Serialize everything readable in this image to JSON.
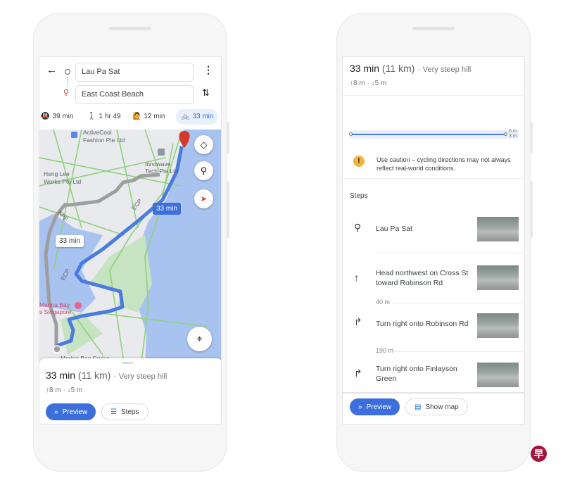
{
  "left_phone": {
    "search": {
      "origin": "Lau Pa Sat",
      "destination": "East Coast Beach"
    },
    "modes": [
      {
        "icon": "transit-icon",
        "label": "39 min"
      },
      {
        "icon": "walk-icon",
        "label": "1 hr 49"
      },
      {
        "icon": "ride-hailing-icon",
        "label": "12 min"
      },
      {
        "icon": "bicycle-icon",
        "label": "33 min",
        "active": true
      }
    ],
    "map": {
      "labels": {
        "place1": "ActiveCool",
        "place1b": "Fashion Pte Ltd",
        "place2": "Heng Lee",
        "place2b": "Works Pte Ltd",
        "place3": "Innowave",
        "place3b": "Tech Pte Ltd",
        "place4": "Marina Bay",
        "place4b": "s Singapore",
        "place5": "Marina Bay Cruise",
        "road1": "KPE",
        "road2": "ECP",
        "road3": "ECP"
      },
      "route_badge_primary": "33 min",
      "route_badge_alt": "33 min"
    },
    "sheet": {
      "duration": "33 min",
      "distance": "(11 km)",
      "note": "Very steep hill",
      "ascent": "8 m",
      "descent": "5 m",
      "preview_label": "Preview",
      "steps_label": "Steps"
    }
  },
  "right_phone": {
    "summary": {
      "duration": "33 min",
      "distance": "(11 km)",
      "note": "Very steep hill",
      "ascent": "8 m",
      "descent": "5 m"
    },
    "elevation": {
      "max_label": "6 m",
      "min_label": "3 m"
    },
    "warning": "Use caution – cycling directions may not always reflect real-world conditions.",
    "steps_heading": "Steps",
    "steps": [
      {
        "icon": "location-pin-icon",
        "text": "Lau Pa Sat"
      },
      {
        "icon": "arrow-up-icon",
        "text": "Head northwest on Cross St toward Robinson Rd",
        "distance": "40 m"
      },
      {
        "icon": "turn-right-icon",
        "text": "Turn right onto Robinson Rd",
        "distance": "190 m"
      },
      {
        "icon": "turn-right-icon",
        "text": "Turn right onto Finlayson Green"
      }
    ],
    "preview_label": "Preview",
    "show_map_label": "Show map"
  },
  "colors": {
    "accent": "#3c6fdc",
    "route": "#4a7be0",
    "sea": "#a9c3f0",
    "warning": "#f2b63c",
    "logo": "#a3143a"
  },
  "watermark": "早"
}
